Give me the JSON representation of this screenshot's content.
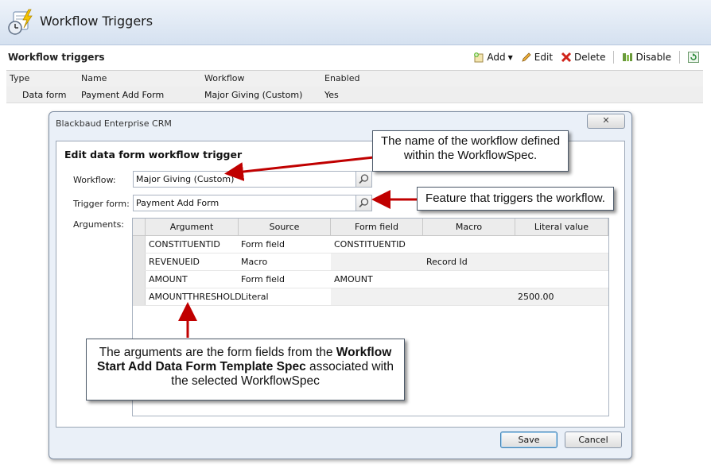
{
  "page": {
    "title": "Workflow Triggers"
  },
  "section": {
    "title": "Workflow triggers"
  },
  "toolbar": {
    "add": "Add",
    "edit": "Edit",
    "delete": "Delete",
    "disable": "Disable"
  },
  "grid": {
    "columns": [
      "Type",
      "Name",
      "Workflow",
      "Enabled"
    ],
    "rows": [
      {
        "type": "Data form",
        "name": "Payment Add Form",
        "workflow": "Major Giving (Custom)",
        "enabled": "Yes"
      }
    ]
  },
  "dialog": {
    "window_title": "Blackbaud Enterprise CRM",
    "heading": "Edit data form workflow trigger",
    "workflow_label": "Workflow:",
    "workflow_value": "Major Giving (Custom)",
    "trigger_label": "Trigger form:",
    "trigger_value": "Payment Add Form",
    "arguments_label": "Arguments:",
    "arg_columns": [
      "Argument",
      "Source",
      "Form field",
      "Macro",
      "Literal value"
    ],
    "arg_rows": [
      {
        "argument": "CONSTITUENTID",
        "source": "Form field",
        "form_field": "CONSTITUENTID",
        "macro": "",
        "literal": ""
      },
      {
        "argument": "REVENUEID",
        "source": "Macro",
        "form_field": "",
        "macro": "Record Id",
        "literal": ""
      },
      {
        "argument": "AMOUNT",
        "source": "Form field",
        "form_field": "AMOUNT",
        "macro": "",
        "literal": ""
      },
      {
        "argument": "AMOUNTTHRESHOLD",
        "source": "Literal",
        "form_field": "",
        "macro": "",
        "literal": "2500.00"
      }
    ],
    "save": "Save",
    "cancel": "Cancel"
  },
  "callouts": {
    "workflow_line1": "The name of the workflow defined",
    "workflow_line2": "within the WorkflowSpec.",
    "trigger": "Feature that triggers the workflow.",
    "args_part1": "The arguments are the form fields from the ",
    "args_bold": "Workflow Start Add Data Form Template Spec",
    "args_part2": " associated with the selected WorkflowSpec"
  },
  "colors": {
    "arrow": "#c00000",
    "header_gradient_bottom": "#d5e1f0",
    "dialog_bg": "#eaf0f8"
  }
}
